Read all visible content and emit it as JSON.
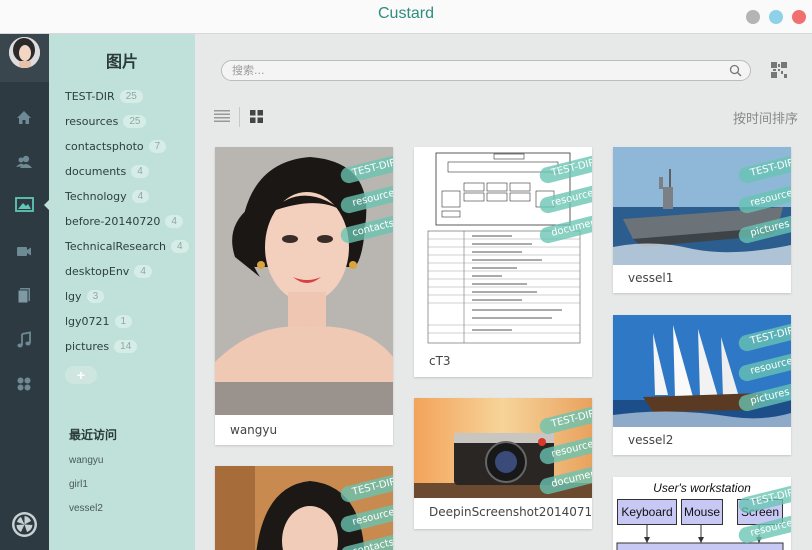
{
  "app": {
    "title": "Custard"
  },
  "window_buttons": [
    {
      "name": "minimize",
      "color": "#b4b4b4"
    },
    {
      "name": "maximize",
      "color": "#8fd1e8"
    },
    {
      "name": "close",
      "color": "#f07070"
    }
  ],
  "rail": {
    "icons": [
      "home-icon",
      "contacts-icon",
      "pictures-icon",
      "video-icon",
      "documents-icon",
      "music-icon",
      "apps-icon"
    ],
    "active": "pictures-icon"
  },
  "sidebar": {
    "heading": "图片",
    "tags": [
      {
        "label": "TEST-DIR",
        "count": "25"
      },
      {
        "label": "resources",
        "count": "25"
      },
      {
        "label": "contactsphoto",
        "count": "7"
      },
      {
        "label": "documents",
        "count": "4"
      },
      {
        "label": "Technology",
        "count": "4"
      },
      {
        "label": "before-20140720",
        "count": "4"
      },
      {
        "label": "TechnicalResearch",
        "count": "4"
      },
      {
        "label": "desktopEnv",
        "count": "4"
      },
      {
        "label": "lgy",
        "count": "3"
      },
      {
        "label": "lgy0721",
        "count": "1"
      },
      {
        "label": "pictures",
        "count": "14"
      }
    ],
    "add_tag": "+",
    "recent_heading": "最近访问",
    "recent": [
      "wangyu",
      "girl1",
      "vessel2"
    ]
  },
  "main": {
    "search_placeholder": "搜索...",
    "sort_label": "按时间排序",
    "cards": [
      {
        "caption": "wangyu",
        "tags": [
          "TEST-DIR",
          "resources",
          "contactsp..."
        ]
      },
      {
        "caption": "",
        "tags": [
          "TEST-DIR",
          "resources",
          "contactsp..."
        ]
      },
      {
        "caption": "cT3",
        "tags": [
          "TEST-DIR",
          "resources",
          "documents"
        ]
      },
      {
        "caption": "DeepinScreenshot2014071...",
        "tags": [
          "TEST-DIR",
          "resources",
          "documents"
        ]
      },
      {
        "caption": "vessel1",
        "tags": [
          "TEST-DIR",
          "resources",
          "pictures"
        ]
      },
      {
        "caption": "vessel2",
        "tags": [
          "TEST-DIR",
          "resources",
          "pictures"
        ]
      },
      {
        "caption": "",
        "tags": [
          "TEST-DIR",
          "resources"
        ],
        "diagram": {
          "title": "User's workstation",
          "boxes": [
            "Keyboard",
            "Mouse",
            "Screen"
          ]
        }
      }
    ]
  }
}
